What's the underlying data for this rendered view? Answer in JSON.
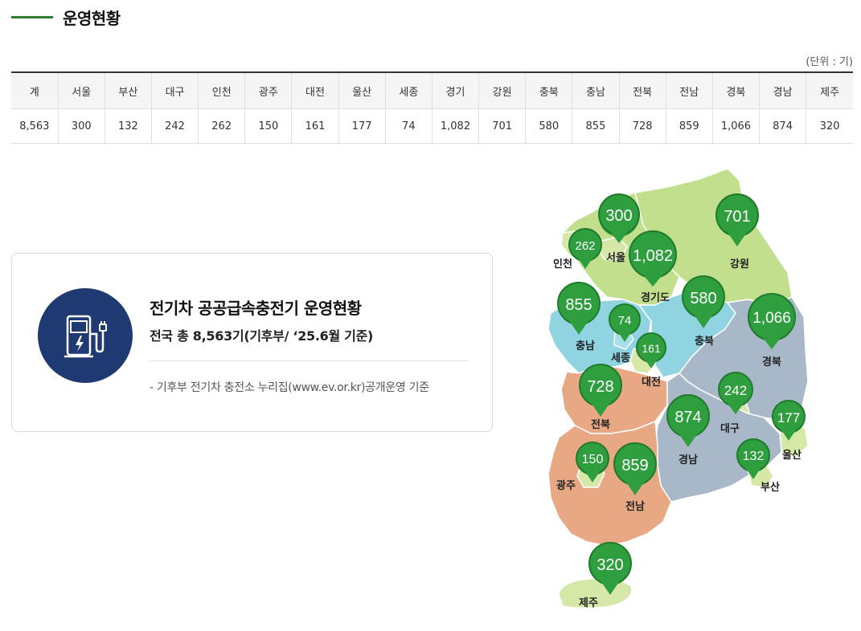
{
  "section_title": "운영현황",
  "unit_label": "(단위 : 기)",
  "table": {
    "headers": [
      "계",
      "서울",
      "부산",
      "대구",
      "인천",
      "광주",
      "대전",
      "울산",
      "세종",
      "경기",
      "강원",
      "충북",
      "충남",
      "전북",
      "전남",
      "경북",
      "경남",
      "제주"
    ],
    "values": [
      "8,563",
      "300",
      "132",
      "242",
      "262",
      "150",
      "161",
      "177",
      "74",
      "1,082",
      "701",
      "580",
      "855",
      "728",
      "859",
      "1,066",
      "874",
      "320"
    ]
  },
  "card": {
    "icon": "ev-charger-icon",
    "title": "전기차 공공급속충전기 운영현황",
    "subtitle": "전국 총 8,563기(기후부/ ‘25.6월 기준)",
    "note": "- 기후부 전기차 충전소 누리집(www.ev.or.kr)공개운영 기준"
  },
  "map": {
    "regions": [
      {
        "key": "seoul",
        "name": "서울",
        "count": "300"
      },
      {
        "key": "incheon",
        "name": "인천",
        "count": "262"
      },
      {
        "key": "gyeonggi",
        "name": "경기도",
        "count": "1,082"
      },
      {
        "key": "gangwon",
        "name": "강원",
        "count": "701"
      },
      {
        "key": "chungnam",
        "name": "충남",
        "count": "855"
      },
      {
        "key": "sejong",
        "name": "세종",
        "count": "74"
      },
      {
        "key": "daejeon",
        "name": "대전",
        "count": "161"
      },
      {
        "key": "chungbuk",
        "name": "충북",
        "count": "580"
      },
      {
        "key": "gyeongbuk",
        "name": "경북",
        "count": "1,066"
      },
      {
        "key": "jeonbuk",
        "name": "전북",
        "count": "728"
      },
      {
        "key": "daegu",
        "name": "대구",
        "count": "242"
      },
      {
        "key": "ulsan",
        "name": "울산",
        "count": "177"
      },
      {
        "key": "gyeongnam",
        "name": "경남",
        "count": "874"
      },
      {
        "key": "busan",
        "name": "부산",
        "count": "132"
      },
      {
        "key": "gwangju",
        "name": "광주",
        "count": "150"
      },
      {
        "key": "jeonnam",
        "name": "전남",
        "count": "859"
      },
      {
        "key": "jeju",
        "name": "제주",
        "count": "320"
      }
    ],
    "colors": {
      "pin": "#2e9e3e",
      "pin_dark": "#1f7a2c",
      "gyeonggi_gangwon": "#c2df8e",
      "chungcheong": "#8fd4e0",
      "gyeongsang": "#a8b8c8",
      "jeolla": "#e8a884",
      "light_region": "#d6e8a8"
    }
  }
}
